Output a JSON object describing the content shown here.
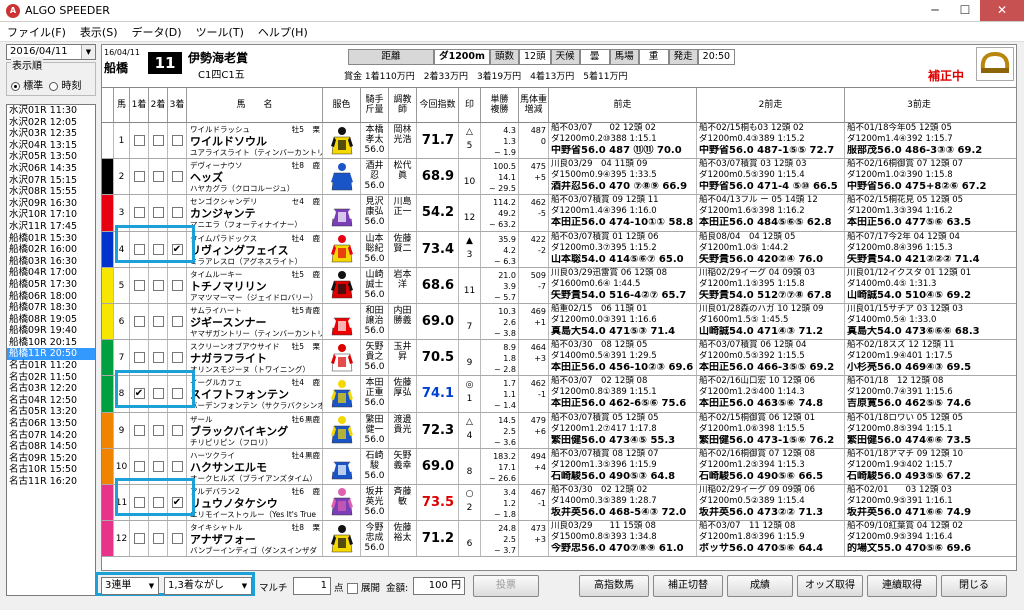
{
  "window": {
    "title": "ALGO SPEEDER",
    "minimize": "─",
    "maximize": "☐",
    "close": "✕"
  },
  "menu": [
    "ファイル(F)",
    "表示(S)",
    "データ(D)",
    "ツール(T)",
    "ヘルプ(H)"
  ],
  "left": {
    "date": "2016/04/11",
    "order_label": "表示順",
    "opt_standard": "標準",
    "opt_time": "時刻",
    "races": [
      "水沢01R 11:30",
      "水沢02R 12:05",
      "水沢03R 12:35",
      "水沢04R 13:15",
      "水沢05R 13:50",
      "水沢06R 14:35",
      "水沢07R 15:15",
      "水沢08R 15:55",
      "水沢09R 16:30",
      "水沢10R 17:10",
      "水沢11R 17:45",
      "船橋01R 15:30",
      "船橋02R 16:00",
      "船橋03R 16:30",
      "船橋04R 17:00",
      "船橋05R 17:30",
      "船橋06R 18:00",
      "船橋07R 18:30",
      "船橋08R 19:05",
      "船橋09R 19:40",
      "船橋10R 20:15",
      "船橋11R 20:50",
      "名古01R 11:20",
      "名古02R 11:50",
      "名古03R 12:20",
      "名古04R 12:50",
      "名古05R 13:20",
      "名古06R 13:50",
      "名古07R 14:20",
      "名古08R 14:50",
      "名古09R 15:20",
      "名古10R 15:50",
      "名古11R 16:20"
    ],
    "selected_index": 21
  },
  "header": {
    "date": "16/04/11",
    "venue": "船橋",
    "race_num": "11",
    "race_name": "伊勢海老賞",
    "race_class": "C1四C1五",
    "dist_label": "距離",
    "dist": "ダ1200m",
    "count_label": "頭数",
    "count": "12頭",
    "weather_label": "天候",
    "weather": "曇",
    "track_label": "馬場",
    "track": "重",
    "post_label": "発走",
    "post": "20:50",
    "prize": "賞金 1着110万円　2着33万円　3着19万円　4着13万円　5着11万円",
    "correction": "補正中"
  },
  "columns": {
    "num": "馬",
    "c1": "1着",
    "c2": "2着",
    "c3": "3着",
    "name": "馬　　名",
    "color": "服色",
    "jockey": "騎手\n斤量",
    "trainer": "調教\n師",
    "index": "今回指数",
    "mark": "印",
    "odds": "単勝\n複勝",
    "weight": "馬体重\n増減",
    "prev1": "前走",
    "prev2": "2前走",
    "prev3": "3前走"
  },
  "horses": [
    {
      "num": "1",
      "c1": false,
      "c2": false,
      "c3": false,
      "top": "ワイルドラッシュ",
      "sex": "牡5",
      "col": "栗",
      "name": "ワイルドソウル",
      "sire": "ユアライスライト（ティンバーカントリー）",
      "jockey": "本橋\n孝太\n56.0",
      "trainer": "岡林\n光浩",
      "index": "71.7",
      "index_color": "#000",
      "mark": "△\n5",
      "odds": "4.3\n1.3\n~ 1.9",
      "wt": "487\n0",
      "p1": [
        "船不03/07　　02 12頭 02",
        "ダ1200m0.2⑩388 1:15.1",
        "中野省56.0 487 ⑪⑪ 70.0"
      ],
      "p2": [
        "船不02/15桐も03 12頭 02",
        "ダ1200m0.4③389 1:15.2",
        "中野省56.0 487-1⑤⑤ 72.7"
      ],
      "p3": [
        "船不01/18今年05 12頭 05",
        "ダ1200m1.4④392 1:15.7",
        "服部茂56.0 486-3③③ 69.2"
      ]
    },
    {
      "num": "2",
      "c1": false,
      "c2": false,
      "c3": false,
      "top": "デヴィーナウソ",
      "sex": "牡8",
      "col": "鹿",
      "name": "ヘッズ",
      "sire": "ハヤカグラ（クロコルージュ）",
      "jockey": "酒井\n忍\n56.0",
      "trainer": "松代\n眞",
      "index": "68.9",
      "index_color": "#000",
      "mark": "\n10",
      "odds": "100.5\n14.1\n~ 29.5",
      "wt": "475\n+5",
      "p1": [
        "川良03/29　04 11頭 09",
        "ダ1500m0.9④395 1:33.5",
        "酒井忍56.0 470 ⑦⑧⑨ 66.9"
      ],
      "p2": [
        "船不03/07積賞 03 12頭 03",
        "ダ1200m0.5⑤390 1:15.4",
        "中野省56.0 471-4 ⑤⑩ 66.5"
      ],
      "p3": [
        "船不02/16桐御賞 07 12頭 07",
        "ダ1200m1.0②390 1:15.8",
        "中野省56.0 475+8②⑥ 67.2"
      ]
    },
    {
      "num": "3",
      "c1": false,
      "c2": false,
      "c3": false,
      "top": "センゴクシャンデリ",
      "sex": "セ4",
      "col": "鹿",
      "name": "カンジャンテ",
      "sire": "マニエラ（フォーティナイナー）",
      "jockey": "見沢\n康弘\n56.0",
      "trainer": "川島\n正一",
      "index": "54.2",
      "index_color": "#000",
      "mark": "\n12",
      "odds": "114.2\n49.2\n~ 63.2",
      "wt": "462\n-5",
      "p1": [
        "船不03/07積賞 09 12頭 11",
        "ダ1200m1.4④396 1:16.0",
        "本田正56.0 474-10①① 58.8"
      ],
      "p2": [
        "船不04/13フル ー 05 14頭 12",
        "ダ1200m1.6⑤398 1:16.2",
        "本田正56.0 484⑤⑥⑤ 62.8"
      ],
      "p3": [
        "船不02/15桐花見 05 12頭 05",
        "ダ1200m1.3③394 1:16.2",
        "本田正56.0 477⑤⑥ 63.5"
      ]
    },
    {
      "num": "4",
      "c1": false,
      "c2": false,
      "c3": true,
      "top": "タイムパラドックス",
      "sex": "牡4",
      "col": "鹿",
      "name": "リヴィングフェイス",
      "sire": "ミラアレスロ（アグネスライト）",
      "jockey": "山本\n聡紀\n56.0",
      "trainer": "佐藤\n賢二",
      "index": "73.4",
      "index_color": "#000",
      "mark": "▲\n3",
      "odds": "35.9\n4.2\n~ 6.3",
      "wt": "422\n-2",
      "p1": [
        "船不03/07積賞 01 12頭 06",
        "ダ1200m0.3⑦395 1:15.2",
        "山本聡54.0 414⑤⑥⑦ 65.0"
      ],
      "p2": [
        "船良08/04　04 12頭 05",
        "ダ1200m1.0⑤ 1:44.2",
        "矢野貴56.0 420②④ 76.0"
      ],
      "p3": [
        "船不07/17今2年 04 12頭 04",
        "ダ1200m0.8④396 1:15.3",
        "矢野貴54.0 421②②② 71.4"
      ]
    },
    {
      "num": "5",
      "c1": false,
      "c2": false,
      "c3": false,
      "top": "タイムルーキー",
      "sex": "牡5",
      "col": "鹿",
      "name": "トチノマリリン",
      "sire": "アマツマーマー（ジェイドロバリー）",
      "jockey": "山崎\n誠士\n56.0",
      "trainer": "岩本\n洋",
      "index": "68.6",
      "index_color": "#000",
      "mark": "\n11",
      "odds": "21.0\n3.9\n~ 5.7",
      "wt": "509\n-7",
      "p1": [
        "川良03/29迅雷賞 06 12頭 08",
        "ダ1600m0.6④ 1:44.5",
        "矢野貴54.0 516-4②⑦ 65.7"
      ],
      "p2": [
        "川稲02/29イーグ 04 09頭 03",
        "ダ1200m1.1⑤395 1:15.8",
        "矢野貴54.0 512⑦⑦⑧ 67.8"
      ],
      "p3": [
        "川良01/12イクスタ 01 12頭 01",
        "ダ1400m0.4⑤ 1:31.3",
        "山崎誠54.0 510④⑤ 69.2"
      ]
    },
    {
      "num": "6",
      "c1": false,
      "c2": false,
      "c3": false,
      "top": "サムライハート",
      "sex": "牡5",
      "col": "青鹿",
      "name": "ジギースンナー",
      "sire": "ヤマザガントリー（ティンバーカントリー）",
      "jockey": "和田\n譲治\n56.0",
      "trainer": "内田\n勝義",
      "index": "69.0",
      "index_color": "#000",
      "mark": "\n7",
      "odds": "10.3\n2.6\n~ 3.8",
      "wt": "469\n+1",
      "p1": [
        "船重02/15　06 11頭 01",
        "ダ1200m0.0③391 1:16.6",
        "真島大54.0 471⑤③ 71.4"
      ],
      "p2": [
        "川良01/28森のハガ 10 12頭 09",
        "ダ1600m1.5⑤ 1:45.5",
        "山崎誠54.0 471④③ 71.2"
      ],
      "p3": [
        "川良01/15サチア 03 12頭 03",
        "ダ1400m0.5④ 1:33.0",
        "真島大54.0 473⑥⑥⑥ 68.3"
      ]
    },
    {
      "num": "7",
      "c1": false,
      "c2": false,
      "c3": false,
      "top": "スクリーンオブアウサイド",
      "sex": "牡5",
      "col": "栗",
      "name": "ナガラフライト",
      "sire": "オリンスモジーヌ（トワイニング）",
      "jockey": "矢野\n貴之\n56.0",
      "trainer": "玉井\n昇",
      "index": "70.5",
      "index_color": "#000",
      "mark": "\n9",
      "odds": "8.9\n1.8\n~ 2.8",
      "wt": "464\n+3",
      "p1": [
        "船不03/30　08 12頭 05",
        "ダ1400m0.5④391 1:29.5",
        "本田正56.0 456-10②③ 69.6"
      ],
      "p2": [
        "船不03/07積賞 06 12頭 04",
        "ダ1200m0.5⑤392 1:15.5",
        "本田正56.0 466-3⑤⑤ 69.2"
      ],
      "p3": [
        "船不02/18スズ 12 12頭 11",
        "ダ1200m1.9④401 1:17.5",
        "小杉亮56.0 469④③ 69.5"
      ]
    },
    {
      "num": "8",
      "c1": true,
      "c2": false,
      "c3": false,
      "top": "イーグルカフェ",
      "sex": "牡4",
      "col": "鹿",
      "name": "スイフトフォンテン",
      "sire": "バーデンフォンテン（サクラバクシンオー）",
      "jockey": "本田\n正重\n56.0",
      "trainer": "佐藤\n厚弘",
      "index": "74.1",
      "index_color": "#0040d0",
      "mark": "◎\n1",
      "odds": "1.7\n1.1\n~ 1.4",
      "wt": "462\n-1",
      "p1": [
        "船不03/07　02 12頭 08",
        "ダ1200m0.8①389 1:15.1",
        "本田正56.0 462-6⑤⑥ 75.6"
      ],
      "p2": [
        "船不02/16山口宏 10 12頭 06",
        "ダ1200m1.2⑤400 1:14.3",
        "本田正56.0 463⑤⑥ 74.8"
      ],
      "p3": [
        "船不01/18　12 12頭 08",
        "ダ1200m0.7④391 1:15.6",
        "吉原寛56.0 462⑤⑤ 74.6"
      ]
    },
    {
      "num": "9",
      "c1": false,
      "c2": false,
      "c3": false,
      "top": "ザール",
      "sex": "牡6",
      "col": "黒鹿",
      "name": "ブラックバイキング",
      "sire": "チリピリピン（フロリ）",
      "jockey": "繁田\n健一\n56.0",
      "trainer": "渡邊\n貴光",
      "index": "72.3",
      "index_color": "#000",
      "mark": "△\n4",
      "odds": "14.5\n2.5\n~ 3.6",
      "wt": "479\n+6",
      "p1": [
        "船不03/07積賞 05 12頭 05",
        "ダ1200m1.2⑦417 1:17.8",
        "繁田健56.0 473④⑤ 55.3"
      ],
      "p2": [
        "船不02/15桐御賞 06 12頭 01",
        "ダ1200m1.0⑥398 1:15.5",
        "繁田健56.0 473-1⑤⑥ 76.2"
      ],
      "p3": [
        "船不01/18ロワい 05 12頭 05",
        "ダ1200m0.8⑤394 1:15.1",
        "繁田健56.0 474⑥⑥ 73.5"
      ]
    },
    {
      "num": "10",
      "c1": false,
      "c2": false,
      "c3": false,
      "top": "ハーツクライ",
      "sex": "牡4",
      "col": "黒鹿",
      "name": "ハクサンエルモ",
      "sire": "オークヒルズ（ブライアンズタイム）",
      "jockey": "石崎\n駿\n56.0",
      "trainer": "矢野\n義幸",
      "index": "69.0",
      "index_color": "#000",
      "mark": "\n8",
      "odds": "183.2\n17.1\n~ 26.6",
      "wt": "494\n+4",
      "p1": [
        "船不03/07積賞 08 12頭 07",
        "ダ1200m1.3⑤396 1:15.9",
        "石崎駿56.0 490⑤③ 64.8"
      ],
      "p2": [
        "船不02/16桐御賞 07 12頭 08",
        "ダ1200m1.2⑤394 1:15.3",
        "石崎駿56.0 490⑤⑥ 66.5"
      ],
      "p3": [
        "船不01/18アマチ 09 12頭 10",
        "ダ1200m1.9③402 1:15.7",
        "石崎駿56.0 493⑤⑤ 67.2"
      ]
    },
    {
      "num": "11",
      "c1": false,
      "c2": false,
      "c3": true,
      "top": "アルデバラン2",
      "sex": "牡6",
      "col": "鹿",
      "name": "リュウノタケシウ",
      "sire": "エリモイーストゥルー（Yes It's True",
      "jockey": "坂井\n英光\n56.0",
      "trainer": "斉藤\n敏",
      "index": "73.5",
      "index_color": "#d00",
      "mark": "○\n2",
      "odds": "3.4\n1.2\n~ 1.8",
      "wt": "467\n-1",
      "p1": [
        "船不03/30　02 12頭 02",
        "ダ1400m0.3⑤389 1:28.7",
        "坂井英56.0 468-5④③ 72.0"
      ],
      "p2": [
        "川稲02/29イーグ 09 09頭 06",
        "ダ1200m0.5②389 1:15.4",
        "坂井英56.0 473②② 71.3"
      ],
      "p3": [
        "船不02/01　　03 12頭 03",
        "ダ1200m0.9⑤391 1:16.1",
        "坂井英56.0 471⑥⑥ 74.9"
      ]
    },
    {
      "num": "12",
      "c1": false,
      "c2": false,
      "c3": false,
      "top": "タイキシャトル",
      "sex": "牡8",
      "col": "栗",
      "name": "アナザフォー",
      "sire": "バンブーインディゴ（ダンスインザダ",
      "jockey": "今野\n忠成\n56.0",
      "trainer": "佐藤\n裕太",
      "index": "71.2",
      "index_color": "#000",
      "mark": "\n6",
      "odds": "24.8\n2.5\n~ 3.7",
      "wt": "473\n+3",
      "p1": [
        "川良03/29　　11 15頭 08",
        "ダ1500m0.8⑤393 1:34.8",
        "今野忠56.0 470⑦⑧⑨ 61.0"
      ],
      "p2": [
        "船不03/07　11 12頭 08",
        "ダ1200m1.8⑤396 1:15.9",
        "ボッサ56.0 470⑤⑥ 64.4"
      ],
      "p3": [
        "船不09/10紅葉賞 04 12頭 02",
        "ダ1200m0.9⑤394 1:16.4",
        "的場文55.0 470⑤⑥ 69.6"
      ]
    }
  ],
  "waku_colors": [
    "#ffffff",
    "#000000",
    "#e60012",
    "#0033cc",
    "#f7e600",
    "#00a040",
    "#f08300",
    "#e7338a"
  ],
  "silk_colors": [
    [
      "#f5d800",
      "#111"
    ],
    [
      "#1a55c8",
      "#1a55c8"
    ],
    [
      "#7a3fb8",
      "#fff"
    ],
    [
      "#f5d800",
      "#e60012"
    ],
    [
      "#d00",
      "#111"
    ],
    [
      "#e00",
      "#fff"
    ],
    [
      "#fff",
      "#d00"
    ],
    [
      "#1a55c8",
      "#f5d800"
    ],
    [
      "#1a55c8",
      "#f5d800"
    ],
    [
      "#1a55c8",
      "#fff"
    ],
    [
      "#7a3fb8",
      "#e060b0"
    ],
    [
      "#f5d800",
      "#111"
    ]
  ],
  "bottom": {
    "bet_type": "3連単",
    "method": "1,3着ながし",
    "multi": "マルチ",
    "points": "1",
    "points_unit": "点",
    "expand": "展開",
    "amount_label": "金額:",
    "amount": "100 円",
    "vote": "投票",
    "btn_high": "高指数馬",
    "btn_corr": "補正切替",
    "btn_result": "成績",
    "btn_odds": "オッズ取得",
    "btn_auto": "連續取得",
    "btn_close": "閉じる"
  }
}
